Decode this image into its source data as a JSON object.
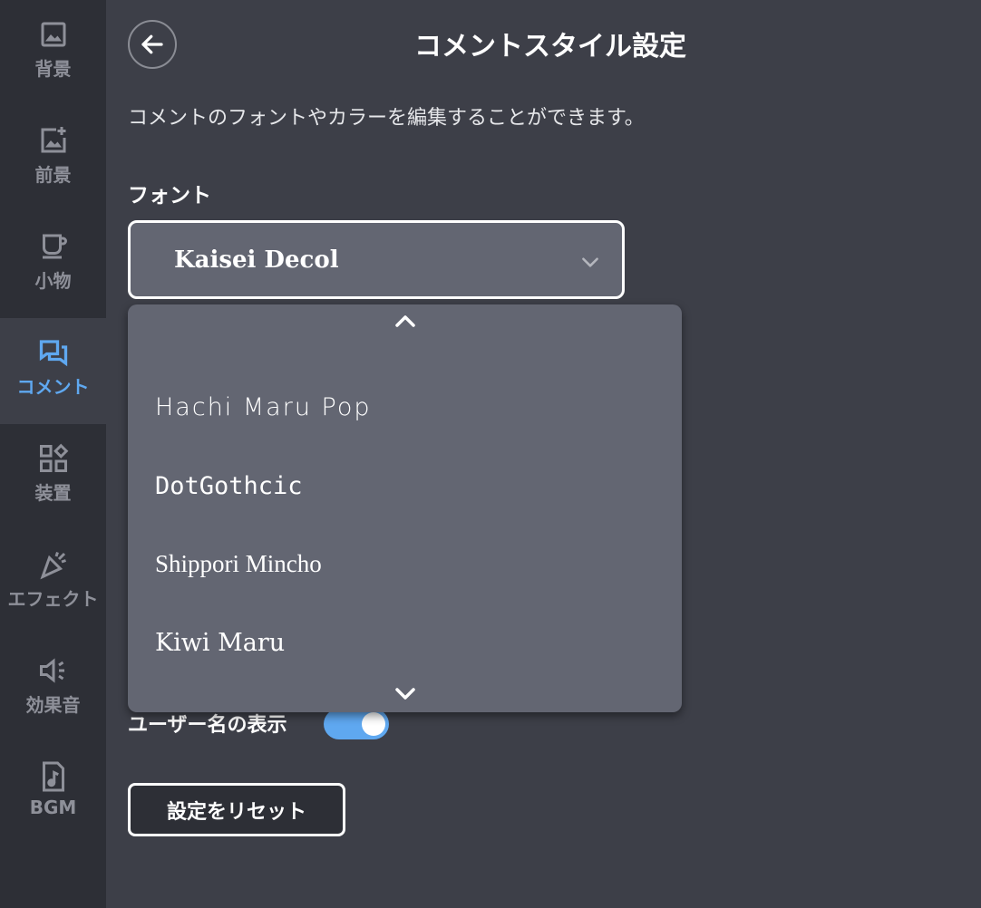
{
  "sidebar": {
    "items": [
      {
        "label": "背景",
        "icon": "image-icon"
      },
      {
        "label": "前景",
        "icon": "add-image-icon"
      },
      {
        "label": "小物",
        "icon": "cup-icon"
      },
      {
        "label": "コメント",
        "icon": "comment-icon",
        "active": true
      },
      {
        "label": "装置",
        "icon": "widgets-icon"
      },
      {
        "label": "エフェクト",
        "icon": "party-popper-icon"
      },
      {
        "label": "効果音",
        "icon": "speaker-icon"
      },
      {
        "label": "BGM",
        "icon": "music-file-icon"
      }
    ]
  },
  "header": {
    "title": "コメントスタイル設定"
  },
  "description": "コメントのフォントやカラーを編集することができます。",
  "font": {
    "label": "フォント",
    "selected": "Kaisei Decol",
    "options": [
      "Hachi Maru Pop",
      "DotGothcic",
      "Shippori Mincho",
      "Kiwi Maru"
    ]
  },
  "username": {
    "label": "ユーザー名の表示",
    "enabled": true
  },
  "reset_label": "設定をリセット",
  "colors": {
    "accent": "#5fa8f0",
    "background": "#3d3f48",
    "sidebar": "#2d2f36",
    "dropdown": "#636672"
  }
}
